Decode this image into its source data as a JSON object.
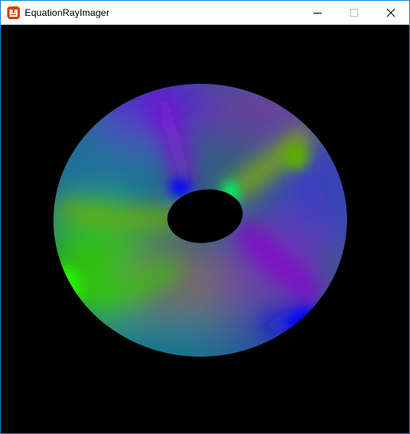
{
  "window": {
    "title": "EquationRayImager",
    "icon": "monogame-logo-icon",
    "accent_color": "#e73c00",
    "border_color": "#1883d7"
  },
  "caption_buttons": {
    "minimize": "minimize-icon",
    "maximize": "maximize-icon",
    "close": "close-icon"
  },
  "viewport": {
    "background": "#000000",
    "render": "torus",
    "colors": [
      "#3cbf00",
      "#7a00c8",
      "#0010e0",
      "#00a080"
    ]
  }
}
